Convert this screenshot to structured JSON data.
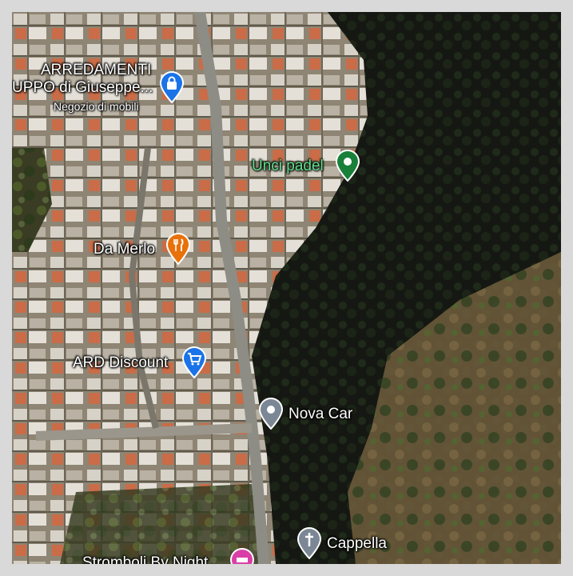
{
  "map": {
    "view": "satellite",
    "places": [
      {
        "id": "arredamenti",
        "title_line1": "ARREDAMENTI",
        "title_line2": "UPPO di Giuseppe...",
        "subtitle": "Negozio di mobili",
        "icon": "shopping-bag-icon",
        "color": "#1a73e8"
      },
      {
        "id": "unci-padel",
        "title": "Unci padel",
        "icon": "sports-place-icon",
        "color": "#188038"
      },
      {
        "id": "da-merlo",
        "title": "Da Merlo",
        "icon": "restaurant-icon",
        "color": "#e8710a"
      },
      {
        "id": "ard-discount",
        "title": "ARD Discount",
        "icon": "shopping-cart-icon",
        "color": "#1a73e8"
      },
      {
        "id": "nova-car",
        "title": "Nova Car",
        "icon": "place-icon",
        "color": "#7b8794"
      },
      {
        "id": "cappella",
        "title": "Cappella",
        "icon": "church-cross-icon",
        "color": "#7b8794"
      },
      {
        "id": "stromboli",
        "title": "Stromboli By Night",
        "icon": "hotel-icon",
        "color": "#d93fa6"
      }
    ]
  }
}
